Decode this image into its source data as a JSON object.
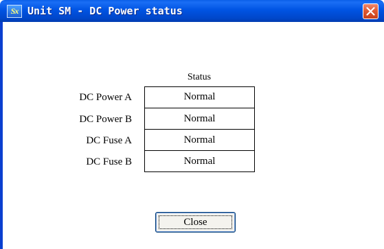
{
  "window": {
    "title": "Unit SM - DC Power status",
    "app_icon_text": "Sx"
  },
  "table": {
    "header": "Status",
    "rows": [
      {
        "label": "DC Power A",
        "status": "Normal"
      },
      {
        "label": "DC Power B",
        "status": "Normal"
      },
      {
        "label": "DC Fuse A",
        "status": "Normal"
      },
      {
        "label": "DC Fuse B",
        "status": "Normal"
      }
    ]
  },
  "buttons": {
    "close_label": "Close"
  },
  "icons": {
    "app": "sx-app-icon",
    "close": "close-icon"
  },
  "colors": {
    "titlebar": "#0054e3",
    "close_button": "#e05a33"
  }
}
